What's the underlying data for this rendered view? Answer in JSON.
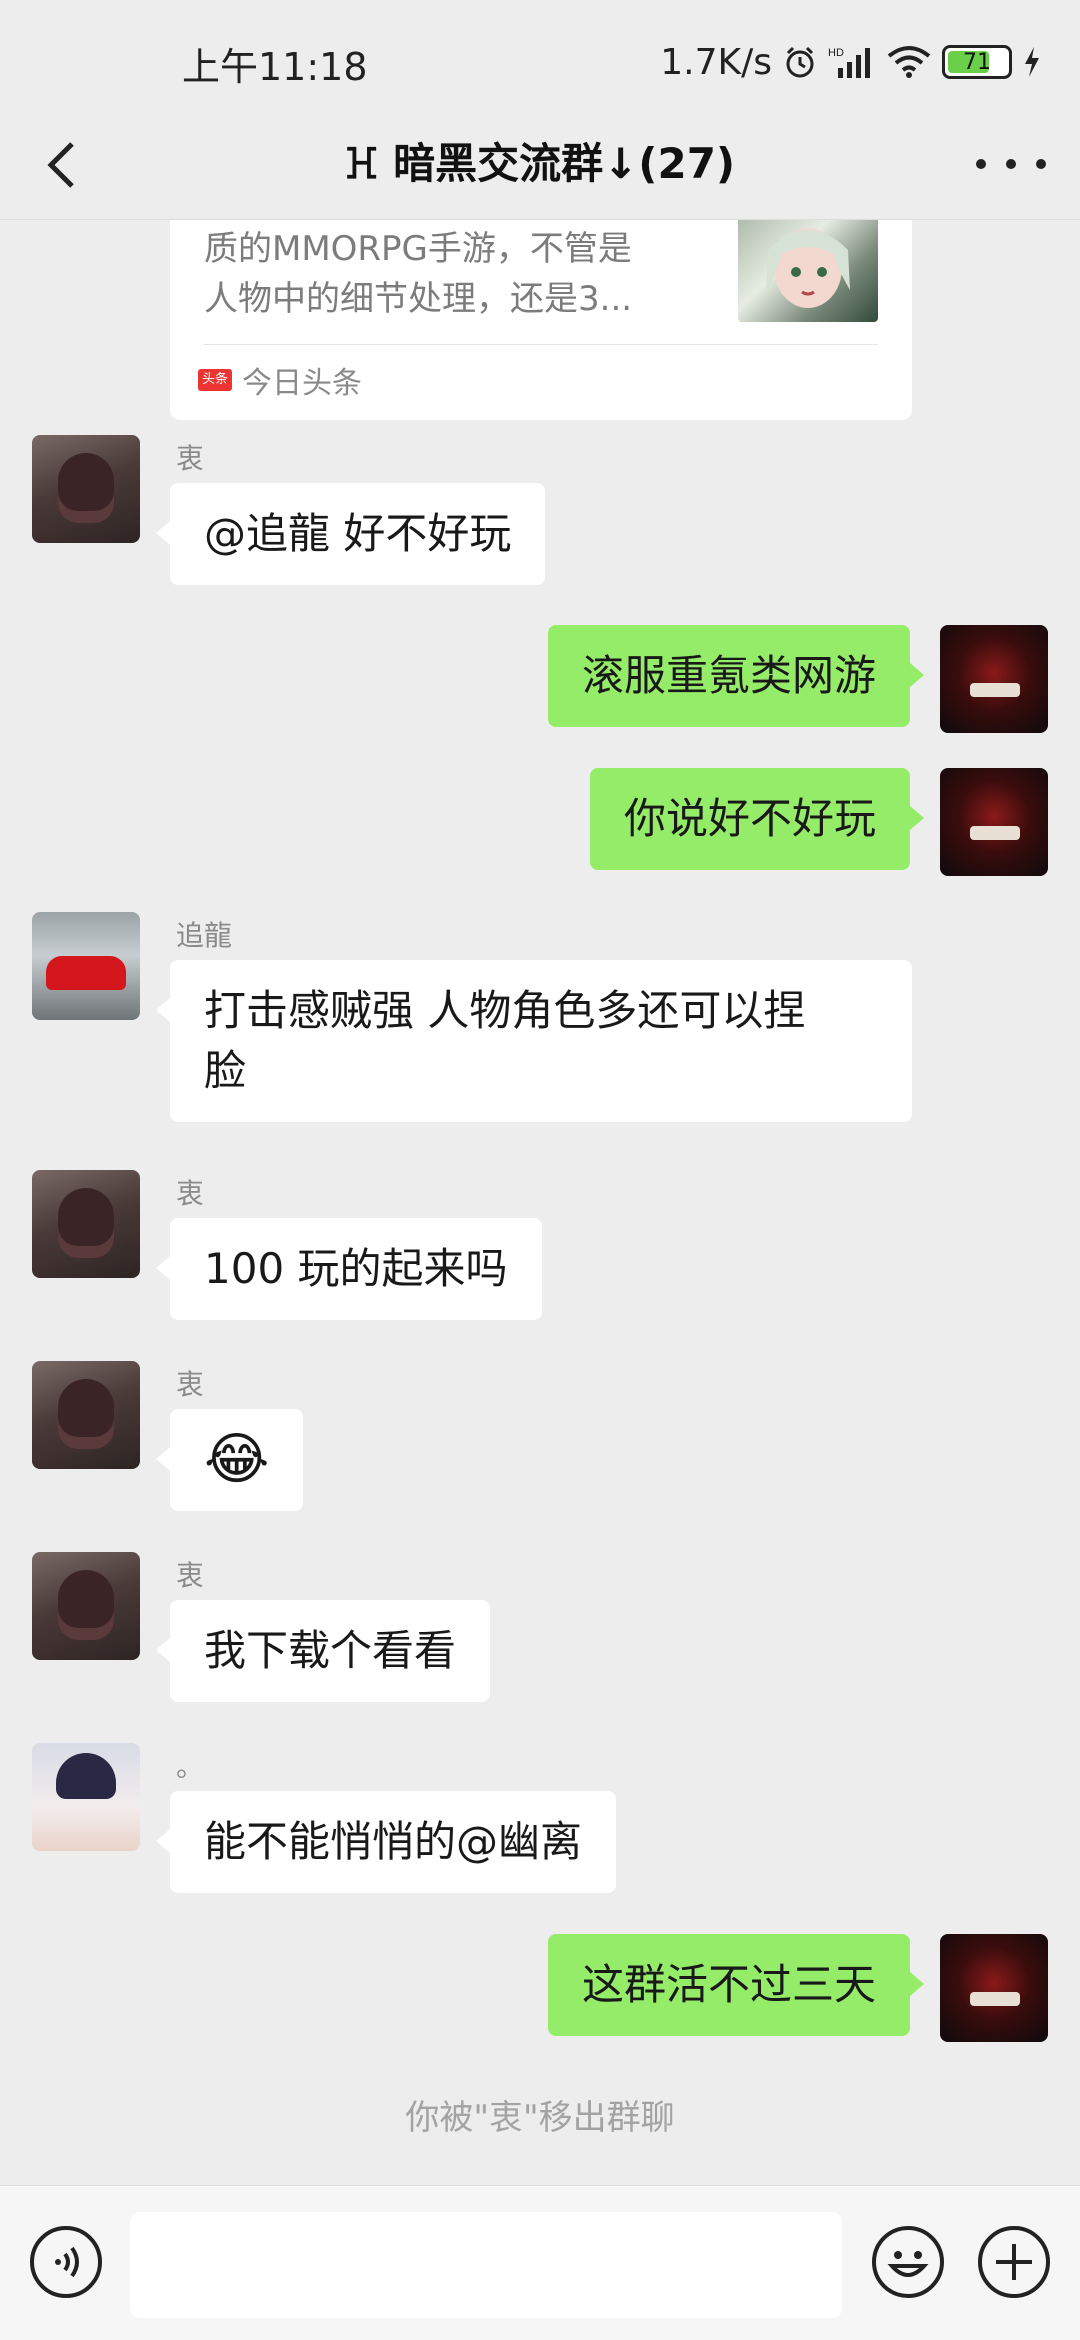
{
  "status_bar": {
    "time": "上午11:18",
    "net_speed": "1.7K/s",
    "battery_level": "71",
    "battery_fraction": 0.71,
    "icons": [
      "alarm-icon",
      "hd-signal-icon",
      "wifi-icon",
      "battery-icon",
      "charging-icon"
    ]
  },
  "header": {
    "title": "ꖾ 暗黑交流群↓(27)",
    "back_icon": "chevron-left-icon",
    "more_icon": "more-dots-icon"
  },
  "shared_card": {
    "text_line1": "质的MMORPG手游，不管是",
    "text_line2": "人物中的细节处理，还是3...",
    "source_badge": "头条",
    "source": "今日头条"
  },
  "messages": [
    {
      "sender": "衷",
      "text": "@追龍  好不好玩",
      "direction": "in",
      "avatar": "hooded-avatar"
    },
    {
      "sender": "",
      "text": "滚服重氪类网游",
      "direction": "out",
      "avatar": "joker-avatar"
    },
    {
      "sender": "",
      "text": "你说好不好玩",
      "direction": "out",
      "avatar": "joker-avatar"
    },
    {
      "sender": "追龍",
      "text_line1": "打击感贼强 人物角色多还可以捏",
      "text_line2": "脸",
      "direction": "in",
      "avatar": "car-avatar"
    },
    {
      "sender": "衷",
      "text": "100 玩的起来吗",
      "direction": "in",
      "avatar": "hooded-avatar"
    },
    {
      "sender": "衷",
      "text": "😂",
      "direction": "in",
      "avatar": "hooded-avatar"
    },
    {
      "sender": "衷",
      "text": "我下载个看看",
      "direction": "in",
      "avatar": "hooded-avatar"
    },
    {
      "sender": "。",
      "text": "能不能悄悄的@幽离",
      "direction": "in",
      "avatar": "anime-boy-avatar"
    },
    {
      "sender": "",
      "text": "这群活不过三天",
      "direction": "out",
      "avatar": "joker-avatar"
    }
  ],
  "system_notice": "你被\"衷\"移出群聊",
  "input_bar": {
    "voice_icon": "voice-icon",
    "emoji_icon": "emoji-icon",
    "plus_icon": "plus-icon",
    "value": ""
  }
}
